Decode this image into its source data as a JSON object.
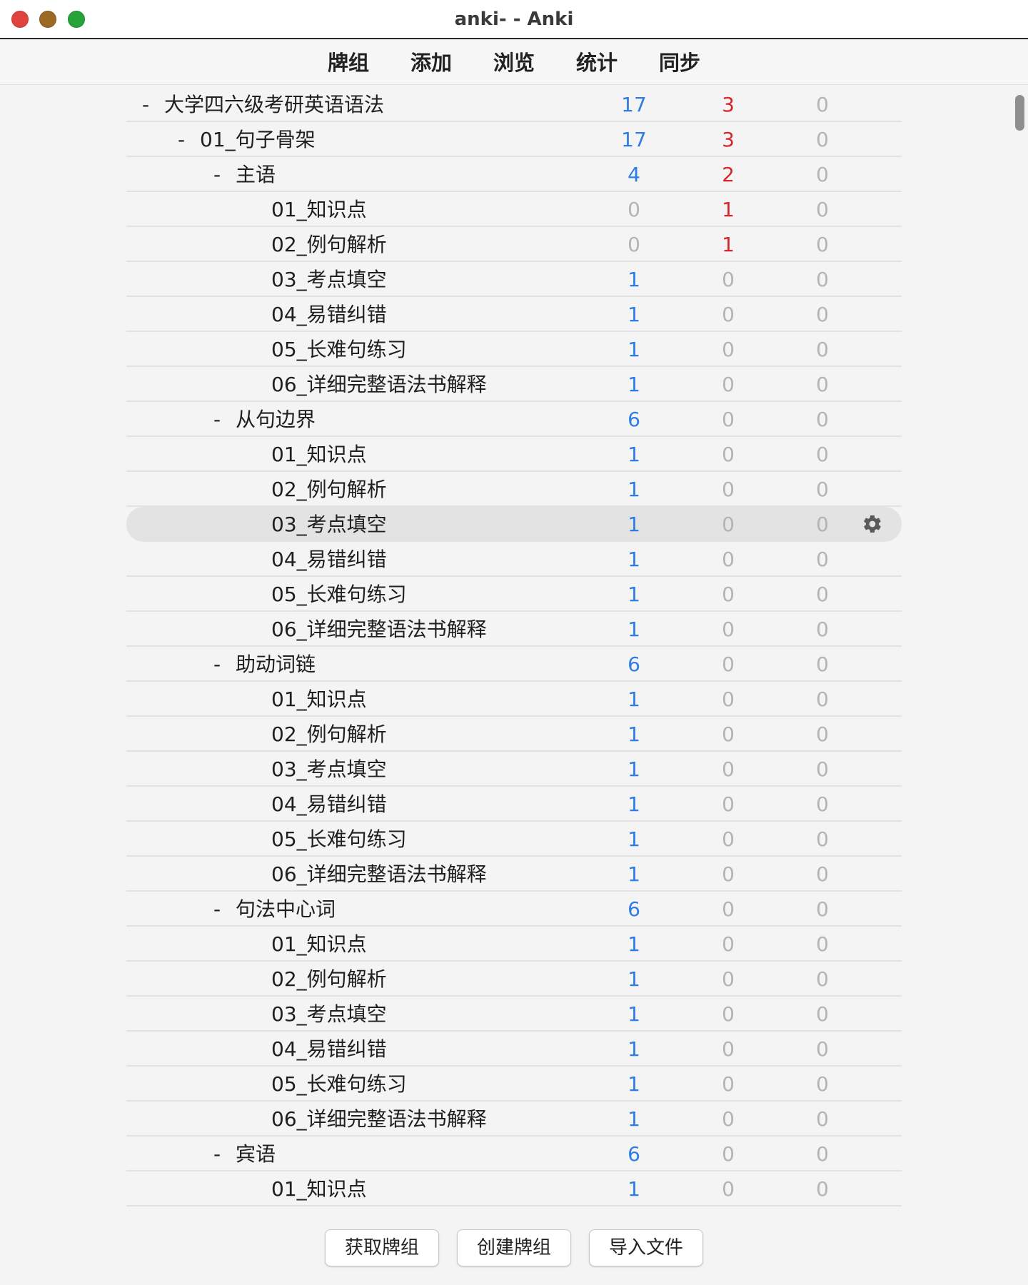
{
  "window": {
    "title": "anki- - Anki"
  },
  "toolbar": {
    "items": [
      "牌组",
      "添加",
      "浏览",
      "统计",
      "同步"
    ]
  },
  "colors": {
    "new": "#2e7de6",
    "learn": "#d7262e",
    "zero": "#b4b4b4"
  },
  "decks": [
    {
      "name": "大学四六级考研英语语法",
      "level": 0,
      "collapse": "-",
      "new": "17",
      "learn": "3",
      "due": "0"
    },
    {
      "name": "01_句子骨架",
      "level": 1,
      "collapse": "-",
      "new": "17",
      "learn": "3",
      "due": "0"
    },
    {
      "name": "主语",
      "level": 2,
      "collapse": "-",
      "new": "4",
      "learn": "2",
      "due": "0"
    },
    {
      "name": "01_知识点",
      "level": 3,
      "collapse": "",
      "new": "0",
      "learn": "1",
      "due": "0"
    },
    {
      "name": "02_例句解析",
      "level": 3,
      "collapse": "",
      "new": "0",
      "learn": "1",
      "due": "0"
    },
    {
      "name": "03_考点填空",
      "level": 3,
      "collapse": "",
      "new": "1",
      "learn": "0",
      "due": "0"
    },
    {
      "name": "04_易错纠错",
      "level": 3,
      "collapse": "",
      "new": "1",
      "learn": "0",
      "due": "0"
    },
    {
      "name": "05_长难句练习",
      "level": 3,
      "collapse": "",
      "new": "1",
      "learn": "0",
      "due": "0"
    },
    {
      "name": "06_详细完整语法书解释",
      "level": 3,
      "collapse": "",
      "new": "1",
      "learn": "0",
      "due": "0"
    },
    {
      "name": "从句边界",
      "level": 2,
      "collapse": "-",
      "new": "6",
      "learn": "0",
      "due": "0"
    },
    {
      "name": "01_知识点",
      "level": 3,
      "collapse": "",
      "new": "1",
      "learn": "0",
      "due": "0"
    },
    {
      "name": "02_例句解析",
      "level": 3,
      "collapse": "",
      "new": "1",
      "learn": "0",
      "due": "0"
    },
    {
      "name": "03_考点填空",
      "level": 3,
      "collapse": "",
      "new": "1",
      "learn": "0",
      "due": "0",
      "selected": true
    },
    {
      "name": "04_易错纠错",
      "level": 3,
      "collapse": "",
      "new": "1",
      "learn": "0",
      "due": "0"
    },
    {
      "name": "05_长难句练习",
      "level": 3,
      "collapse": "",
      "new": "1",
      "learn": "0",
      "due": "0"
    },
    {
      "name": "06_详细完整语法书解释",
      "level": 3,
      "collapse": "",
      "new": "1",
      "learn": "0",
      "due": "0"
    },
    {
      "name": "助动词链",
      "level": 2,
      "collapse": "-",
      "new": "6",
      "learn": "0",
      "due": "0"
    },
    {
      "name": "01_知识点",
      "level": 3,
      "collapse": "",
      "new": "1",
      "learn": "0",
      "due": "0"
    },
    {
      "name": "02_例句解析",
      "level": 3,
      "collapse": "",
      "new": "1",
      "learn": "0",
      "due": "0"
    },
    {
      "name": "03_考点填空",
      "level": 3,
      "collapse": "",
      "new": "1",
      "learn": "0",
      "due": "0"
    },
    {
      "name": "04_易错纠错",
      "level": 3,
      "collapse": "",
      "new": "1",
      "learn": "0",
      "due": "0"
    },
    {
      "name": "05_长难句练习",
      "level": 3,
      "collapse": "",
      "new": "1",
      "learn": "0",
      "due": "0"
    },
    {
      "name": "06_详细完整语法书解释",
      "level": 3,
      "collapse": "",
      "new": "1",
      "learn": "0",
      "due": "0"
    },
    {
      "name": "句法中心词",
      "level": 2,
      "collapse": "-",
      "new": "6",
      "learn": "0",
      "due": "0"
    },
    {
      "name": "01_知识点",
      "level": 3,
      "collapse": "",
      "new": "1",
      "learn": "0",
      "due": "0"
    },
    {
      "name": "02_例句解析",
      "level": 3,
      "collapse": "",
      "new": "1",
      "learn": "0",
      "due": "0"
    },
    {
      "name": "03_考点填空",
      "level": 3,
      "collapse": "",
      "new": "1",
      "learn": "0",
      "due": "0"
    },
    {
      "name": "04_易错纠错",
      "level": 3,
      "collapse": "",
      "new": "1",
      "learn": "0",
      "due": "0"
    },
    {
      "name": "05_长难句练习",
      "level": 3,
      "collapse": "",
      "new": "1",
      "learn": "0",
      "due": "0"
    },
    {
      "name": "06_详细完整语法书解释",
      "level": 3,
      "collapse": "",
      "new": "1",
      "learn": "0",
      "due": "0"
    },
    {
      "name": "宾语",
      "level": 2,
      "collapse": "-",
      "new": "6",
      "learn": "0",
      "due": "0"
    },
    {
      "name": "01_知识点",
      "level": 3,
      "collapse": "",
      "new": "1",
      "learn": "0",
      "due": "0"
    }
  ],
  "bottom": {
    "buttons": [
      "获取牌组",
      "创建牌组",
      "导入文件"
    ]
  },
  "icons": {
    "options": "gear-icon"
  }
}
